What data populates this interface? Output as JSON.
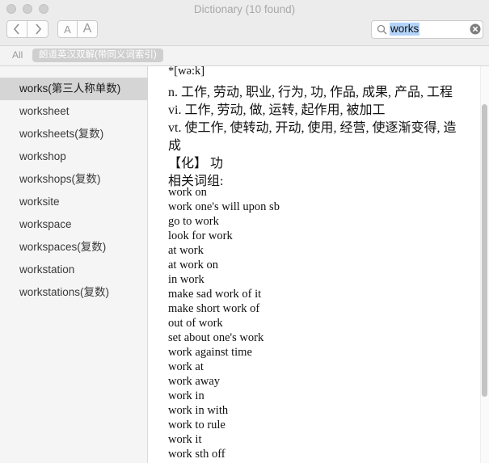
{
  "window": {
    "title": "Dictionary (10 found)"
  },
  "toolbar": {
    "back_icon": "chevron-left-icon",
    "forward_icon": "chevron-right-icon",
    "font_smaller_label": "A",
    "font_larger_label": "A",
    "search": {
      "value": "works",
      "clear_icon": "clear-icon",
      "search_icon": "magnifier-icon"
    }
  },
  "scope": {
    "all_label": "All",
    "dict_label": "朗道英汉双解(带同义词索引)"
  },
  "sidebar": {
    "items": [
      {
        "label": "works(第三人称单数)",
        "selected": true
      },
      {
        "label": "worksheet"
      },
      {
        "label": "worksheets(复数)"
      },
      {
        "label": "workshop"
      },
      {
        "label": "workshops(复数)"
      },
      {
        "label": "worksite"
      },
      {
        "label": "workspace"
      },
      {
        "label": "workspaces(复数)"
      },
      {
        "label": "workstation"
      },
      {
        "label": "workstations(复数)"
      }
    ]
  },
  "entry": {
    "pronunciation": "*[wə:k]",
    "senses": [
      "n. 工作, 劳动, 职业, 行为, 功, 作品, 成果, 产品, 工程",
      "vi. 工作, 劳动, 做, 运转, 起作用, 被加工",
      "vt. 使工作, 使转动, 开动, 使用, 经营, 使逐渐变得, 造",
      "成",
      "【化】 功",
      "相关词组:"
    ],
    "phrases": [
      "work on",
      "work one's will upon sb",
      "go to work",
      "look for work",
      "at work",
      "at work on",
      "in work",
      "make sad work of it",
      "make short work of",
      "out of work",
      "set about one's work",
      "work against time",
      "work at",
      "work away",
      "work in",
      "work in with",
      "work to rule",
      "work it",
      "work sth off"
    ]
  }
}
